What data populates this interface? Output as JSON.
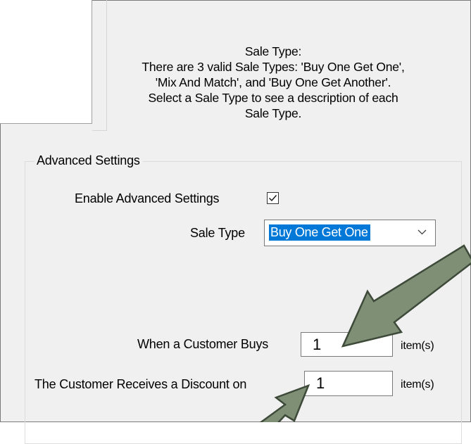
{
  "help_text": {
    "lines": [
      "Sale Type:",
      "There are 3 valid Sale Types: 'Buy One Get One',",
      "'Mix And Match', and 'Buy One Get Another'.",
      "Select a Sale Type to see a description of each",
      "Sale Type."
    ]
  },
  "advanced": {
    "group_title": "Advanced Settings",
    "enable_label": "Enable Advanced Settings",
    "enable_checked": true,
    "sale_type_label": "Sale Type",
    "sale_type_value": "Buy One Get One"
  },
  "fields": {
    "buys_label": "When a Customer Buys",
    "buys_value": "1",
    "buys_unit": "item(s)",
    "discount_label": "The Customer Receives a Discount on",
    "discount_value": "1",
    "discount_unit": "item(s)"
  },
  "colors": {
    "window_bg": "#f0f0f0",
    "selection_bg": "#0078d7",
    "annotation_arrow": "#7e8f76",
    "annotation_arrow_outline": "#3e4a39"
  },
  "icons": {
    "checkbox": "checkmark-icon",
    "combo": "chevron-down-icon",
    "annotations": "annotation-arrow-icon"
  }
}
